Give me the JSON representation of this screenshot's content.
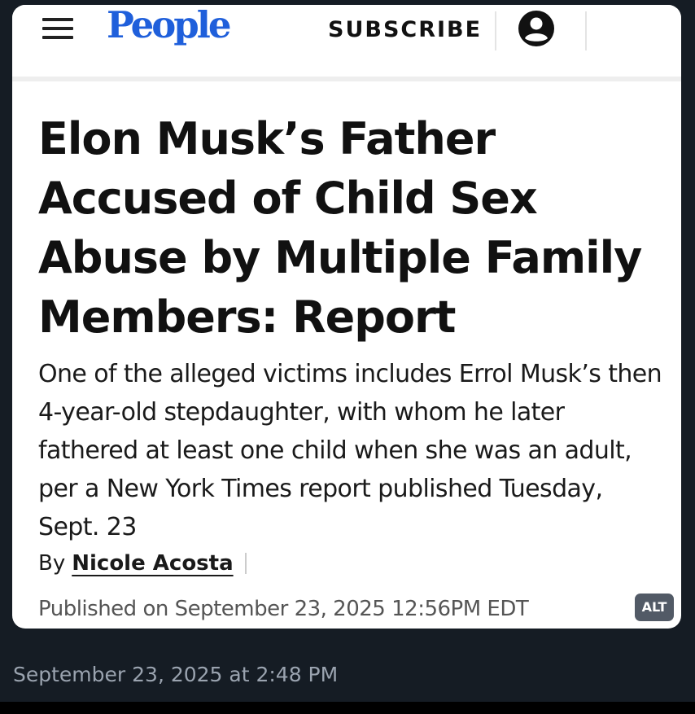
{
  "header": {
    "logo_text": "People",
    "subscribe_label": "SUBSCRIBE",
    "menu_icon": "hamburger-menu-icon",
    "account_icon": "account-icon"
  },
  "article": {
    "headline": "Elon Musk’s Father Accused of Child Sex Abuse by Multiple Family Members: Report",
    "dek": "One of the alleged victims includes Errol Musk’s then 4-year-old stepdaughter, with whom he later fathered at least one child when she was an adult, per a New York Times report published Tuesday, Sept. 23",
    "byline_prefix": "By",
    "author": "Nicole Acosta",
    "published": "Published on September 23, 2025 12:56PM EDT"
  },
  "image": {
    "alt_badge": "ALT"
  },
  "post": {
    "timestamp": "September 23, 2025 at 2:48 PM"
  },
  "colors": {
    "brand": "#1f5fdb",
    "background": "#151c24",
    "card": "#ffffff",
    "timestamp": "#9aa3af",
    "alt_badge": "#525a66"
  }
}
